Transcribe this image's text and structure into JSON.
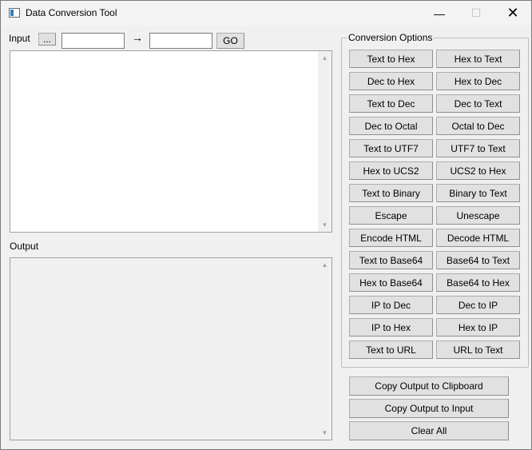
{
  "window": {
    "title": "Data Conversion Tool",
    "minimize": "—",
    "maximize": "☐",
    "close": "✕"
  },
  "input_row": {
    "label": "Input",
    "browse_label": "...",
    "from_value": "",
    "arrow": "→",
    "to_value": "",
    "go_label": "GO"
  },
  "input_area": {
    "value": ""
  },
  "output": {
    "label": "Output",
    "value": ""
  },
  "conversion_options": {
    "title": "Conversion Options",
    "buttons": [
      "Text to Hex",
      "Hex to Text",
      "Dec to Hex",
      "Hex to Dec",
      "Text to Dec",
      "Dec to Text",
      "Dec to Octal",
      "Octal to Dec",
      "Text to UTF7",
      "UTF7 to Text",
      "Hex to UCS2",
      "UCS2 to Hex",
      "Text to Binary",
      "Binary to Text",
      "Escape",
      "Unescape",
      "Encode HTML",
      "Decode HTML",
      "Text to Base64",
      "Base64 to Text",
      "Hex to Base64",
      "Base64 to Hex",
      "IP to Dec",
      "Dec to IP",
      "IP to Hex",
      "Hex to IP",
      "Text to URL",
      "URL to Text"
    ]
  },
  "actions": {
    "copy_to_clipboard": "Copy Output to Clipboard",
    "copy_to_input": "Copy Output to Input",
    "clear_all": "Clear All"
  }
}
